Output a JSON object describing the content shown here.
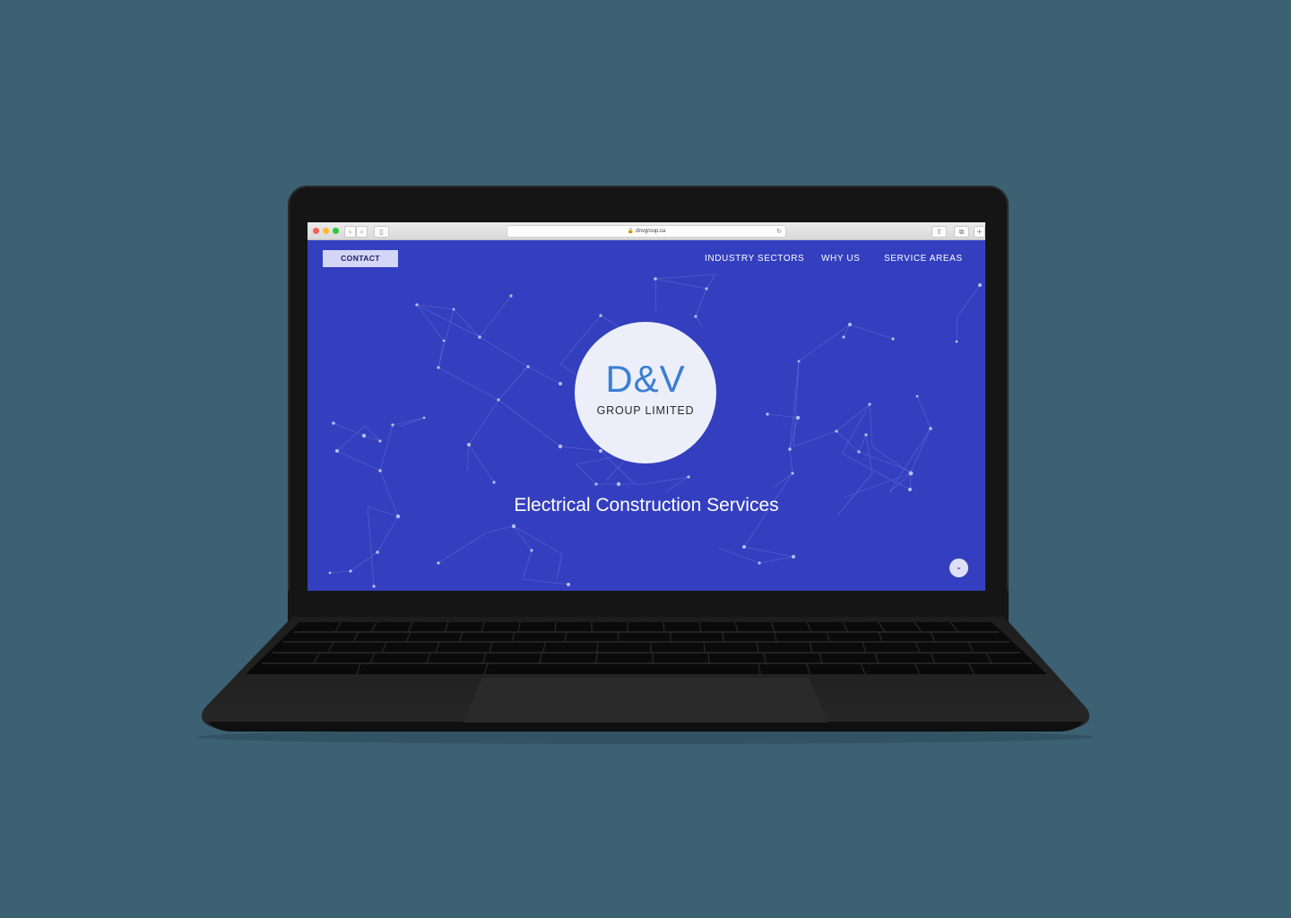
{
  "browser": {
    "url": "dnvgroup.ca",
    "lock_icon": "lock-icon",
    "reload_icon": "reload-icon",
    "back_icon": "chevron-left-icon",
    "forward_icon": "chevron-right-icon"
  },
  "site": {
    "contact_label": "CONTACT",
    "nav": [
      "INDUSTRY SECTORS",
      "WHY US",
      "SERVICE AREAS"
    ],
    "logo_main": "D&V",
    "logo_sub": "GROUP LIMITED",
    "headline": "Electrical Construction Services",
    "scroll_icon": "chevron-down-icon"
  },
  "colors": {
    "page_background": "#3b6173",
    "hero_background": "#343fbf",
    "logo_blue": "#3a7fd3",
    "contact_button": "#d3d6f4"
  }
}
